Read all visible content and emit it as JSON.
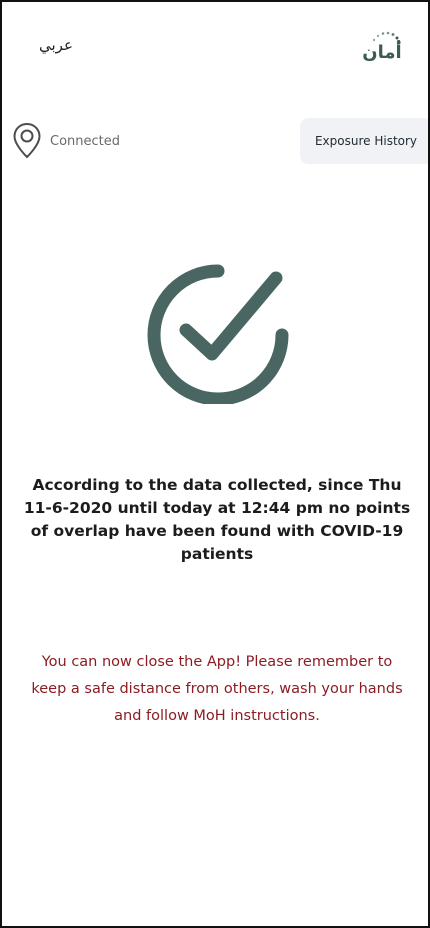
{
  "header": {
    "language_toggle": "عربي",
    "logo_text": "أمان"
  },
  "status": {
    "icon": "location-pin-icon",
    "text": "Connected"
  },
  "exposure_history_label": "Exposure History",
  "check_icon": "check-circle-icon",
  "result_message": "According to the data collected, since Thu 11-6-2020 until today at 12:44 pm no points of overlap have been found with COVID-19 patients",
  "advice_message": "You can now close the App! Please remember to keep a safe distance from others, wash your hands and follow MoH instructions.",
  "colors": {
    "brand": "#3d5b55",
    "check": "#4a6662",
    "advice_text": "#8c1c24",
    "button_bg": "#f0f2f5"
  }
}
